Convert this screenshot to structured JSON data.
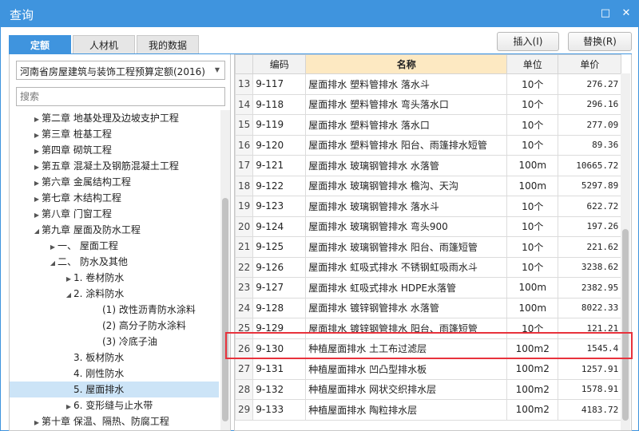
{
  "window": {
    "title": "查询",
    "min_icon": "□",
    "close_icon": "✕"
  },
  "tabs": [
    {
      "label": "定额",
      "active": true
    },
    {
      "label": "人材机",
      "active": false
    },
    {
      "label": "我的数据",
      "active": false
    }
  ],
  "buttons": {
    "insert": "插入(I)",
    "replace": "替换(R)"
  },
  "left": {
    "quota_library": "河南省房屋建筑与装饰工程预算定额(2016)",
    "search_placeholder": "搜索",
    "tree": [
      {
        "label": "第二章 地基处理及边坡支护工程",
        "level": 1,
        "toggle": "collapsed"
      },
      {
        "label": "第三章 桩基工程",
        "level": 1,
        "toggle": "collapsed"
      },
      {
        "label": "第四章 砌筑工程",
        "level": 1,
        "toggle": "collapsed"
      },
      {
        "label": "第五章 混凝土及钢筋混凝土工程",
        "level": 1,
        "toggle": "collapsed"
      },
      {
        "label": "第六章 金属结构工程",
        "level": 1,
        "toggle": "collapsed"
      },
      {
        "label": "第七章 木结构工程",
        "level": 1,
        "toggle": "collapsed"
      },
      {
        "label": "第八章 门窗工程",
        "level": 1,
        "toggle": "collapsed"
      },
      {
        "label": "第九章 屋面及防水工程",
        "level": 1,
        "toggle": "expanded"
      },
      {
        "label": "一、 屋面工程",
        "level": 2,
        "toggle": "collapsed"
      },
      {
        "label": "二、 防水及其他",
        "level": 2,
        "toggle": "expanded"
      },
      {
        "label": "1. 卷材防水",
        "level": 3,
        "toggle": "collapsed"
      },
      {
        "label": "2. 涂料防水",
        "level": 3,
        "toggle": "expanded"
      },
      {
        "label": "(1) 改性沥青防水涂料",
        "level": 4,
        "toggle": "none"
      },
      {
        "label": "(2) 高分子防水涂料",
        "level": 4,
        "toggle": "none"
      },
      {
        "label": "(3) 冷底子油",
        "level": 4,
        "toggle": "none"
      },
      {
        "label": "3. 板材防水",
        "level": 3,
        "toggle": "none"
      },
      {
        "label": "4. 刚性防水",
        "level": 3,
        "toggle": "none"
      },
      {
        "label": "5. 屋面排水",
        "level": 3,
        "toggle": "none",
        "selected": true
      },
      {
        "label": "6. 变形缝与止水带",
        "level": 3,
        "toggle": "collapsed"
      },
      {
        "label": "第十章 保温、隔热、防腐工程",
        "level": 1,
        "toggle": "collapsed"
      }
    ]
  },
  "table": {
    "columns": {
      "code": "编码",
      "name": "名称",
      "unit": "单位",
      "price": "单价"
    },
    "highlighted_row": 26,
    "rows": [
      {
        "idx": "13",
        "code": "9-117",
        "name": "屋面排水 塑料管排水 落水斗",
        "unit": "10个",
        "price": "276.27"
      },
      {
        "idx": "14",
        "code": "9-118",
        "name": "屋面排水 塑料管排水 弯头落水口",
        "unit": "10个",
        "price": "296.16"
      },
      {
        "idx": "15",
        "code": "9-119",
        "name": "屋面排水 塑料管排水 落水口",
        "unit": "10个",
        "price": "277.09"
      },
      {
        "idx": "16",
        "code": "9-120",
        "name": "屋面排水 塑料管排水 阳台、雨篷排水短管",
        "unit": "10个",
        "price": "89.36"
      },
      {
        "idx": "17",
        "code": "9-121",
        "name": "屋面排水 玻璃钢管排水 水落管",
        "unit": "100m",
        "price": "10665.72"
      },
      {
        "idx": "18",
        "code": "9-122",
        "name": "屋面排水 玻璃钢管排水 檐沟、天沟",
        "unit": "100m",
        "price": "5297.89"
      },
      {
        "idx": "19",
        "code": "9-123",
        "name": "屋面排水 玻璃钢管排水 落水斗",
        "unit": "10个",
        "price": "622.72"
      },
      {
        "idx": "20",
        "code": "9-124",
        "name": "屋面排水 玻璃钢管排水 弯头900",
        "unit": "10个",
        "price": "197.26"
      },
      {
        "idx": "21",
        "code": "9-125",
        "name": "屋面排水 玻璃钢管排水 阳台、雨篷短管",
        "unit": "10个",
        "price": "221.62"
      },
      {
        "idx": "22",
        "code": "9-126",
        "name": "屋面排水 虹吸式排水 不锈钢虹吸雨水斗",
        "unit": "10个",
        "price": "3238.62"
      },
      {
        "idx": "23",
        "code": "9-127",
        "name": "屋面排水 虹吸式排水 HDPE水落管",
        "unit": "100m",
        "price": "2382.95"
      },
      {
        "idx": "24",
        "code": "9-128",
        "name": "屋面排水 镀锌钢管排水 水落管",
        "unit": "100m",
        "price": "8022.33"
      },
      {
        "idx": "25",
        "code": "9-129",
        "name": "屋面排水 镀锌钢管排水 阳台、雨篷短管",
        "unit": "10个",
        "price": "121.21"
      },
      {
        "idx": "26",
        "code": "9-130",
        "name": "种植屋面排水 土工布过滤层",
        "unit": "100m2",
        "price": "1545.4"
      },
      {
        "idx": "27",
        "code": "9-131",
        "name": "种植屋面排水 凹凸型排水板",
        "unit": "100m2",
        "price": "1257.91"
      },
      {
        "idx": "28",
        "code": "9-132",
        "name": "种植屋面排水 网状交织排水层",
        "unit": "100m2",
        "price": "1578.91"
      },
      {
        "idx": "29",
        "code": "9-133",
        "name": "种植屋面排水 陶粒排水层",
        "unit": "100m2",
        "price": "4183.72"
      }
    ]
  },
  "colors": {
    "accent": "#3f94de",
    "highlight_border": "#e8323c",
    "sorted_header": "#fde9c2",
    "selected_row": "#cce4f7"
  }
}
